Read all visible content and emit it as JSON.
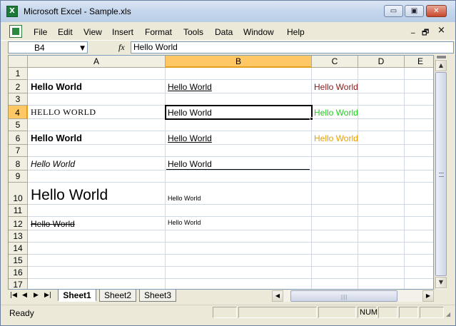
{
  "window": {
    "title": "Microsoft Excel - Sample.xls",
    "minimize_glyph": "▭",
    "restore_glyph": "▣",
    "close_glyph": "✕"
  },
  "menu": {
    "items": [
      "File",
      "Edit",
      "View",
      "Insert",
      "Format",
      "Tools",
      "Data",
      "Window",
      "Help"
    ],
    "doc_minimize": "_",
    "doc_restore": "🗗",
    "doc_close": "×"
  },
  "formula_bar": {
    "name_box": "B4",
    "fx_label": "fx",
    "formula": "Hello World"
  },
  "grid": {
    "columns": [
      "A",
      "B",
      "C",
      "D",
      "E"
    ],
    "selected_column": "B",
    "rows": [
      "1",
      "2",
      "3",
      "4",
      "5",
      "6",
      "7",
      "8",
      "9",
      "10",
      "11",
      "12",
      "13",
      "14",
      "15",
      "16",
      "17"
    ],
    "selected_row": "4",
    "cells": {
      "A2": "Hello World",
      "B2": "Hello World",
      "C2": "Hello World",
      "A4": "HELLO WORLD",
      "B4": "Hello World",
      "C4": "Hello World",
      "A6": "Hello World",
      "B6": "Hello World",
      "C6": "Hello World",
      "A8": "Hello World",
      "B8": "Hello World",
      "A10": "Hello World",
      "B10": "Hello World",
      "A12": "Hello World",
      "B12": "Hello World"
    },
    "colors": {
      "C2": "#8b1a1a",
      "C4": "#22cc22",
      "C6": "#e6a000"
    }
  },
  "sheets": {
    "tabs": [
      "Sheet1",
      "Sheet2",
      "Sheet3"
    ],
    "active": "Sheet1"
  },
  "status": {
    "ready": "Ready",
    "num": "NUM"
  }
}
